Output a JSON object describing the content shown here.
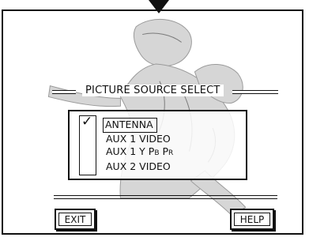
{
  "menu": {
    "title": "PICTURE SOURCE SELECT",
    "selected_mark": "✓",
    "sources": [
      {
        "label": "ANTENNA",
        "selected": true
      },
      {
        "label": "AUX 1 VIDEO",
        "selected": false
      },
      {
        "main": "AUX 1 Y ",
        "p1": "P",
        "p1_sub": "B",
        "p2": " P",
        "p2_sub": "R",
        "selected": false
      },
      {
        "label": "AUX 2 VIDEO",
        "selected": false
      }
    ]
  },
  "buttons": {
    "exit_label": "EXIT",
    "help_label": "HELP"
  },
  "pointer_icon": "down-arrow-icon",
  "background_graphic": "baseball-player-watermark"
}
